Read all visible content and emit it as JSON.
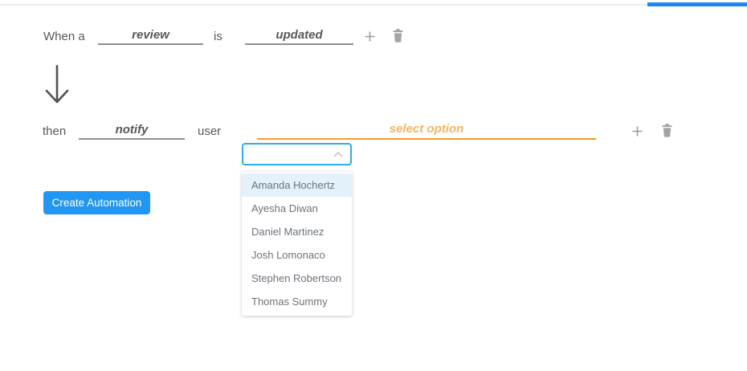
{
  "tabs": {
    "active_indicator": "active-tab-underline"
  },
  "trigger_row": {
    "prefix_label": "When a",
    "entity_value": "review",
    "connector_label": "is",
    "event_value": "updated",
    "add_icon": "plus-icon",
    "delete_icon": "trash-icon"
  },
  "flow": {
    "arrow_icon": "arrow-down-icon"
  },
  "action_row": {
    "prefix_label": "then",
    "action_value": "notify",
    "target_label": "user",
    "select_placeholder": "select option",
    "add_icon": "plus-icon",
    "delete_icon": "trash-icon"
  },
  "dropdown": {
    "search_value": "",
    "collapse_icon": "chevron-up-icon",
    "highlighted_index": 0,
    "options": [
      "Amanda Hochertz",
      "Ayesha Diwan",
      "Daniel Martinez",
      "Josh Lomonaco",
      "Stephen Robertson",
      "Thomas Summy"
    ]
  },
  "footer": {
    "create_button_label": "Create Automation"
  },
  "colors": {
    "active_tab_blue": "#1e88f5",
    "button_blue": "#2196f3",
    "dropdown_border_blue": "#2dafe6",
    "highlight_row_blue": "#e3f1fb",
    "select_orange_line": "#f59b2d",
    "select_orange_text": "#f8b45c",
    "label_gray": "#56595c",
    "underline_gray": "#8f8f8f",
    "icon_gray": "#a3a3a3"
  }
}
